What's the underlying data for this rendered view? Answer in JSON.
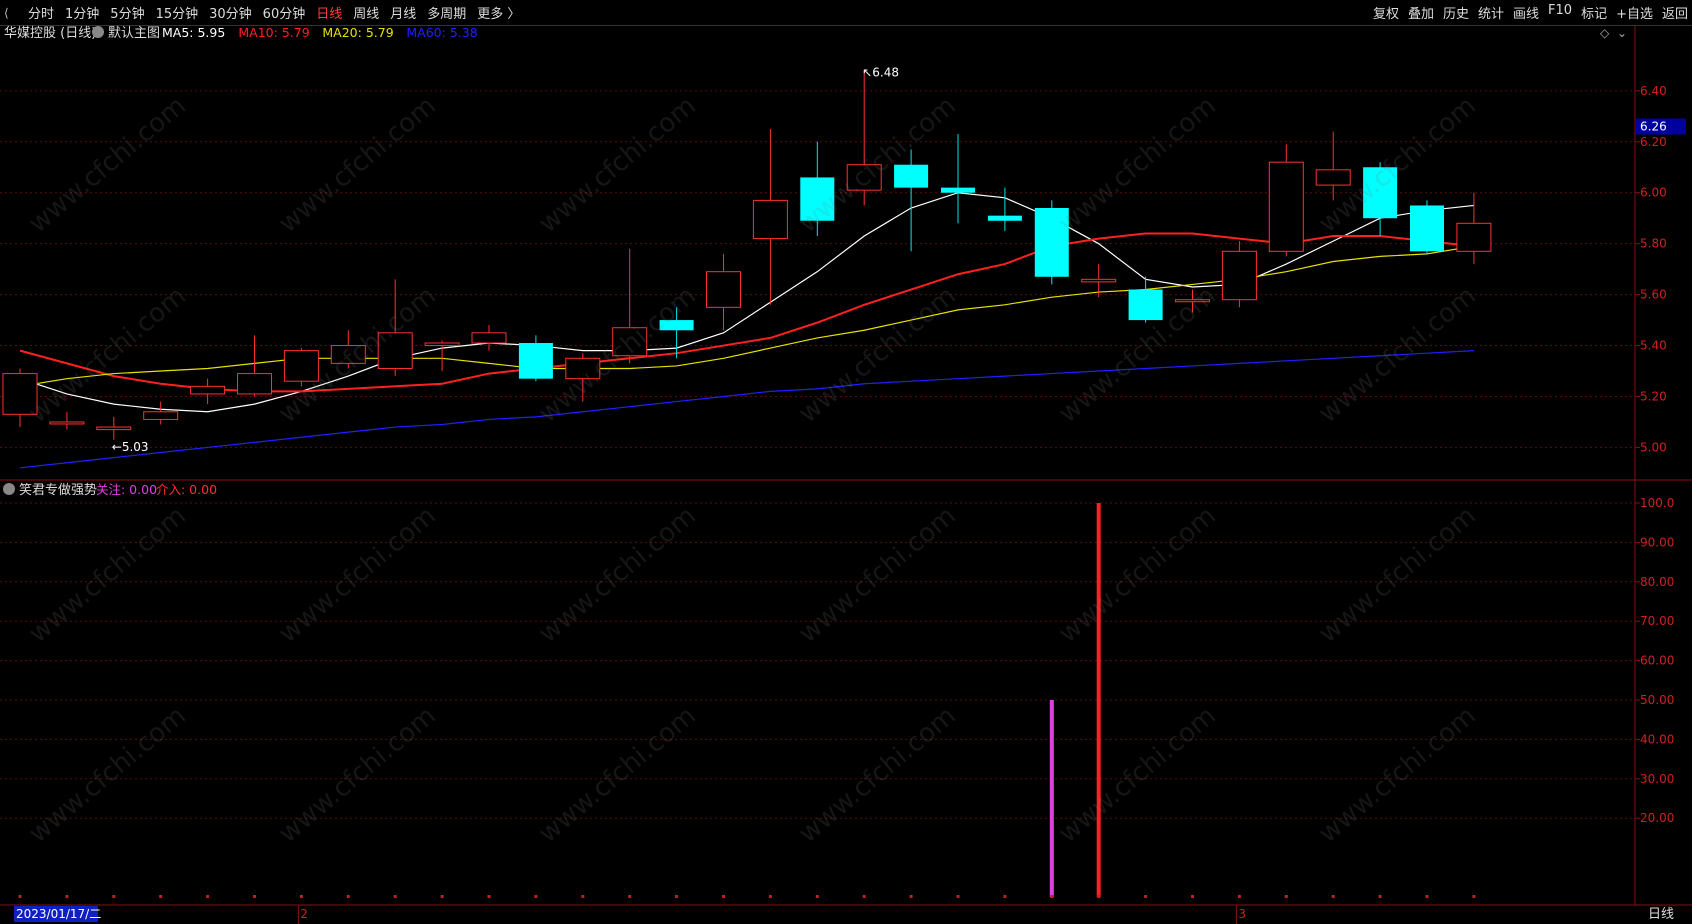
{
  "toolbar": {
    "periods": [
      "分时",
      "1分钟",
      "5分钟",
      "15分钟",
      "30分钟",
      "60分钟",
      "日线",
      "周线",
      "月线",
      "多周期",
      "更多 〉"
    ],
    "active_period": "日线",
    "right_buttons": [
      "复权",
      "叠加",
      "历史",
      "统计",
      "画线",
      "F10",
      "标记",
      "+自选",
      "返回"
    ]
  },
  "main_panel": {
    "stock_name": "华媒控股 (日线)",
    "chart_name": "默认主图",
    "ma_labels": [
      {
        "text": "MA5: 5.95",
        "color": "#ffffff"
      },
      {
        "text": "MA10: 5.79",
        "color": "#ff2020"
      },
      {
        "text": "MA20: 5.79",
        "color": "#e8e000"
      },
      {
        "text": "MA60: 5.38",
        "color": "#2020ff"
      }
    ],
    "high_label": "6.48",
    "low_label": "5.03",
    "current_price_tag": "6.26",
    "y_ticks": [
      "6.40",
      "6.20",
      "6.00",
      "5.80",
      "5.60",
      "5.40",
      "5.20",
      "5.00"
    ]
  },
  "indicator_panel": {
    "name": "笑君专做强势",
    "labels": [
      {
        "text": "关注: 0.00",
        "color": "#e040e0"
      },
      {
        "text": "介入: 0.00",
        "color": "#ff3030"
      }
    ],
    "y_ticks": [
      "100.0",
      "90.00",
      "80.00",
      "70.00",
      "60.00",
      "50.00",
      "40.00",
      "30.00",
      "20.00"
    ]
  },
  "bottom_bar": {
    "date_label": "2023/01/17/二",
    "month_marks": [
      "2",
      "3"
    ],
    "period_label": "日线"
  },
  "watermark": "www.cfchi.com",
  "chart_data": [
    {
      "type": "candlestick",
      "title": "华媒控股 (日线)",
      "ylim": [
        4.88,
        6.58
      ],
      "candles": [
        {
          "o": 5.13,
          "h": 5.31,
          "l": 5.08,
          "c": 5.29
        },
        {
          "o": 5.1,
          "h": 5.14,
          "l": 5.07,
          "c": 5.1
        },
        {
          "o": 5.07,
          "h": 5.12,
          "l": 5.03,
          "c": 5.08
        },
        {
          "o": 5.11,
          "h": 5.18,
          "l": 5.09,
          "c": 5.14
        },
        {
          "o": 5.21,
          "h": 5.27,
          "l": 5.17,
          "c": 5.24
        },
        {
          "o": 5.21,
          "h": 5.44,
          "l": 5.2,
          "c": 5.29
        },
        {
          "o": 5.26,
          "h": 5.39,
          "l": 5.24,
          "c": 5.38
        },
        {
          "o": 5.33,
          "h": 5.46,
          "l": 5.31,
          "c": 5.4
        },
        {
          "o": 5.31,
          "h": 5.66,
          "l": 5.28,
          "c": 5.45
        },
        {
          "o": 5.4,
          "h": 5.42,
          "l": 5.3,
          "c": 5.41
        },
        {
          "o": 5.41,
          "h": 5.48,
          "l": 5.38,
          "c": 5.45
        },
        {
          "o": 5.41,
          "h": 5.44,
          "l": 5.26,
          "c": 5.27
        },
        {
          "o": 5.27,
          "h": 5.37,
          "l": 5.18,
          "c": 5.35
        },
        {
          "o": 5.36,
          "h": 5.78,
          "l": 5.33,
          "c": 5.47
        },
        {
          "o": 5.5,
          "h": 5.55,
          "l": 5.35,
          "c": 5.46
        },
        {
          "o": 5.55,
          "h": 5.76,
          "l": 5.46,
          "c": 5.69
        },
        {
          "o": 5.82,
          "h": 6.25,
          "l": 5.56,
          "c": 5.97
        },
        {
          "o": 6.06,
          "h": 6.2,
          "l": 5.83,
          "c": 5.89
        },
        {
          "o": 6.01,
          "h": 6.48,
          "l": 5.95,
          "c": 6.11
        },
        {
          "o": 6.11,
          "h": 6.17,
          "l": 5.77,
          "c": 6.02
        },
        {
          "o": 6.02,
          "h": 6.23,
          "l": 5.88,
          "c": 6.0
        },
        {
          "o": 5.91,
          "h": 6.02,
          "l": 5.85,
          "c": 5.89
        },
        {
          "o": 5.94,
          "h": 5.97,
          "l": 5.64,
          "c": 5.67
        },
        {
          "o": 5.65,
          "h": 5.72,
          "l": 5.59,
          "c": 5.66
        },
        {
          "o": 5.62,
          "h": 5.67,
          "l": 5.49,
          "c": 5.5
        },
        {
          "o": 5.58,
          "h": 5.62,
          "l": 5.53,
          "c": 5.58
        },
        {
          "o": 5.58,
          "h": 5.81,
          "l": 5.55,
          "c": 5.77
        },
        {
          "o": 5.77,
          "h": 6.19,
          "l": 5.75,
          "c": 6.12
        },
        {
          "o": 6.03,
          "h": 6.24,
          "l": 5.97,
          "c": 6.09
        },
        {
          "o": 6.1,
          "h": 6.12,
          "l": 5.83,
          "c": 5.9
        },
        {
          "o": 5.95,
          "h": 5.97,
          "l": 5.76,
          "c": 5.77
        },
        {
          "o": 5.77,
          "h": 6.0,
          "l": 5.72,
          "c": 5.88
        }
      ],
      "series": [
        {
          "name": "MA5",
          "color": "#ffffff",
          "values": [
            5.27,
            5.21,
            5.17,
            5.15,
            5.14,
            5.17,
            5.22,
            5.28,
            5.35,
            5.39,
            5.41,
            5.4,
            5.38,
            5.38,
            5.39,
            5.45,
            5.57,
            5.69,
            5.83,
            5.94,
            6.0,
            5.98,
            5.9,
            5.8,
            5.66,
            5.63,
            5.64,
            5.72,
            5.81,
            5.9,
            5.93,
            5.95
          ]
        },
        {
          "name": "MA10",
          "color": "#ff2020",
          "values": [
            5.38,
            5.33,
            5.28,
            5.25,
            5.23,
            5.22,
            5.22,
            5.23,
            5.24,
            5.25,
            5.29,
            5.31,
            5.33,
            5.35,
            5.37,
            5.4,
            5.43,
            5.49,
            5.56,
            5.62,
            5.68,
            5.72,
            5.79,
            5.82,
            5.84,
            5.84,
            5.82,
            5.8,
            5.83,
            5.83,
            5.81,
            5.79
          ]
        },
        {
          "name": "MA20",
          "color": "#e8e000",
          "values": [
            5.24,
            5.27,
            5.29,
            5.3,
            5.31,
            5.33,
            5.35,
            5.35,
            5.35,
            5.35,
            5.33,
            5.31,
            5.31,
            5.31,
            5.32,
            5.35,
            5.39,
            5.43,
            5.46,
            5.5,
            5.54,
            5.56,
            5.59,
            5.61,
            5.62,
            5.64,
            5.66,
            5.69,
            5.73,
            5.75,
            5.76,
            5.79
          ]
        },
        {
          "name": "MA60",
          "color": "#2020ff",
          "values": [
            4.92,
            4.94,
            4.96,
            4.98,
            5.0,
            5.02,
            5.04,
            5.06,
            5.08,
            5.09,
            5.11,
            5.12,
            5.14,
            5.16,
            5.18,
            5.2,
            5.22,
            5.23,
            5.25,
            5.26,
            5.27,
            5.28,
            5.29,
            5.3,
            5.31,
            5.32,
            5.33,
            5.34,
            5.35,
            5.36,
            5.37,
            5.38
          ]
        }
      ]
    },
    {
      "type": "bar",
      "title": "笑君专做强势",
      "ylim": [
        0,
        100
      ],
      "series": [
        {
          "name": "关注",
          "color": "#e040e0",
          "values": [
            0,
            0,
            0,
            0,
            0,
            0,
            0,
            0,
            0,
            0,
            0,
            0,
            0,
            0,
            0,
            0,
            0,
            0,
            0,
            0,
            0,
            0,
            50,
            0,
            0,
            0,
            0,
            0,
            0,
            0,
            0,
            0
          ]
        },
        {
          "name": "介入",
          "color": "#ff2020",
          "values": [
            0,
            0,
            0,
            0,
            0,
            0,
            0,
            0,
            0,
            0,
            0,
            0,
            0,
            0,
            0,
            0,
            0,
            0,
            0,
            0,
            0,
            0,
            0,
            100,
            0,
            0,
            0,
            0,
            0,
            0,
            0,
            0
          ]
        }
      ]
    }
  ]
}
